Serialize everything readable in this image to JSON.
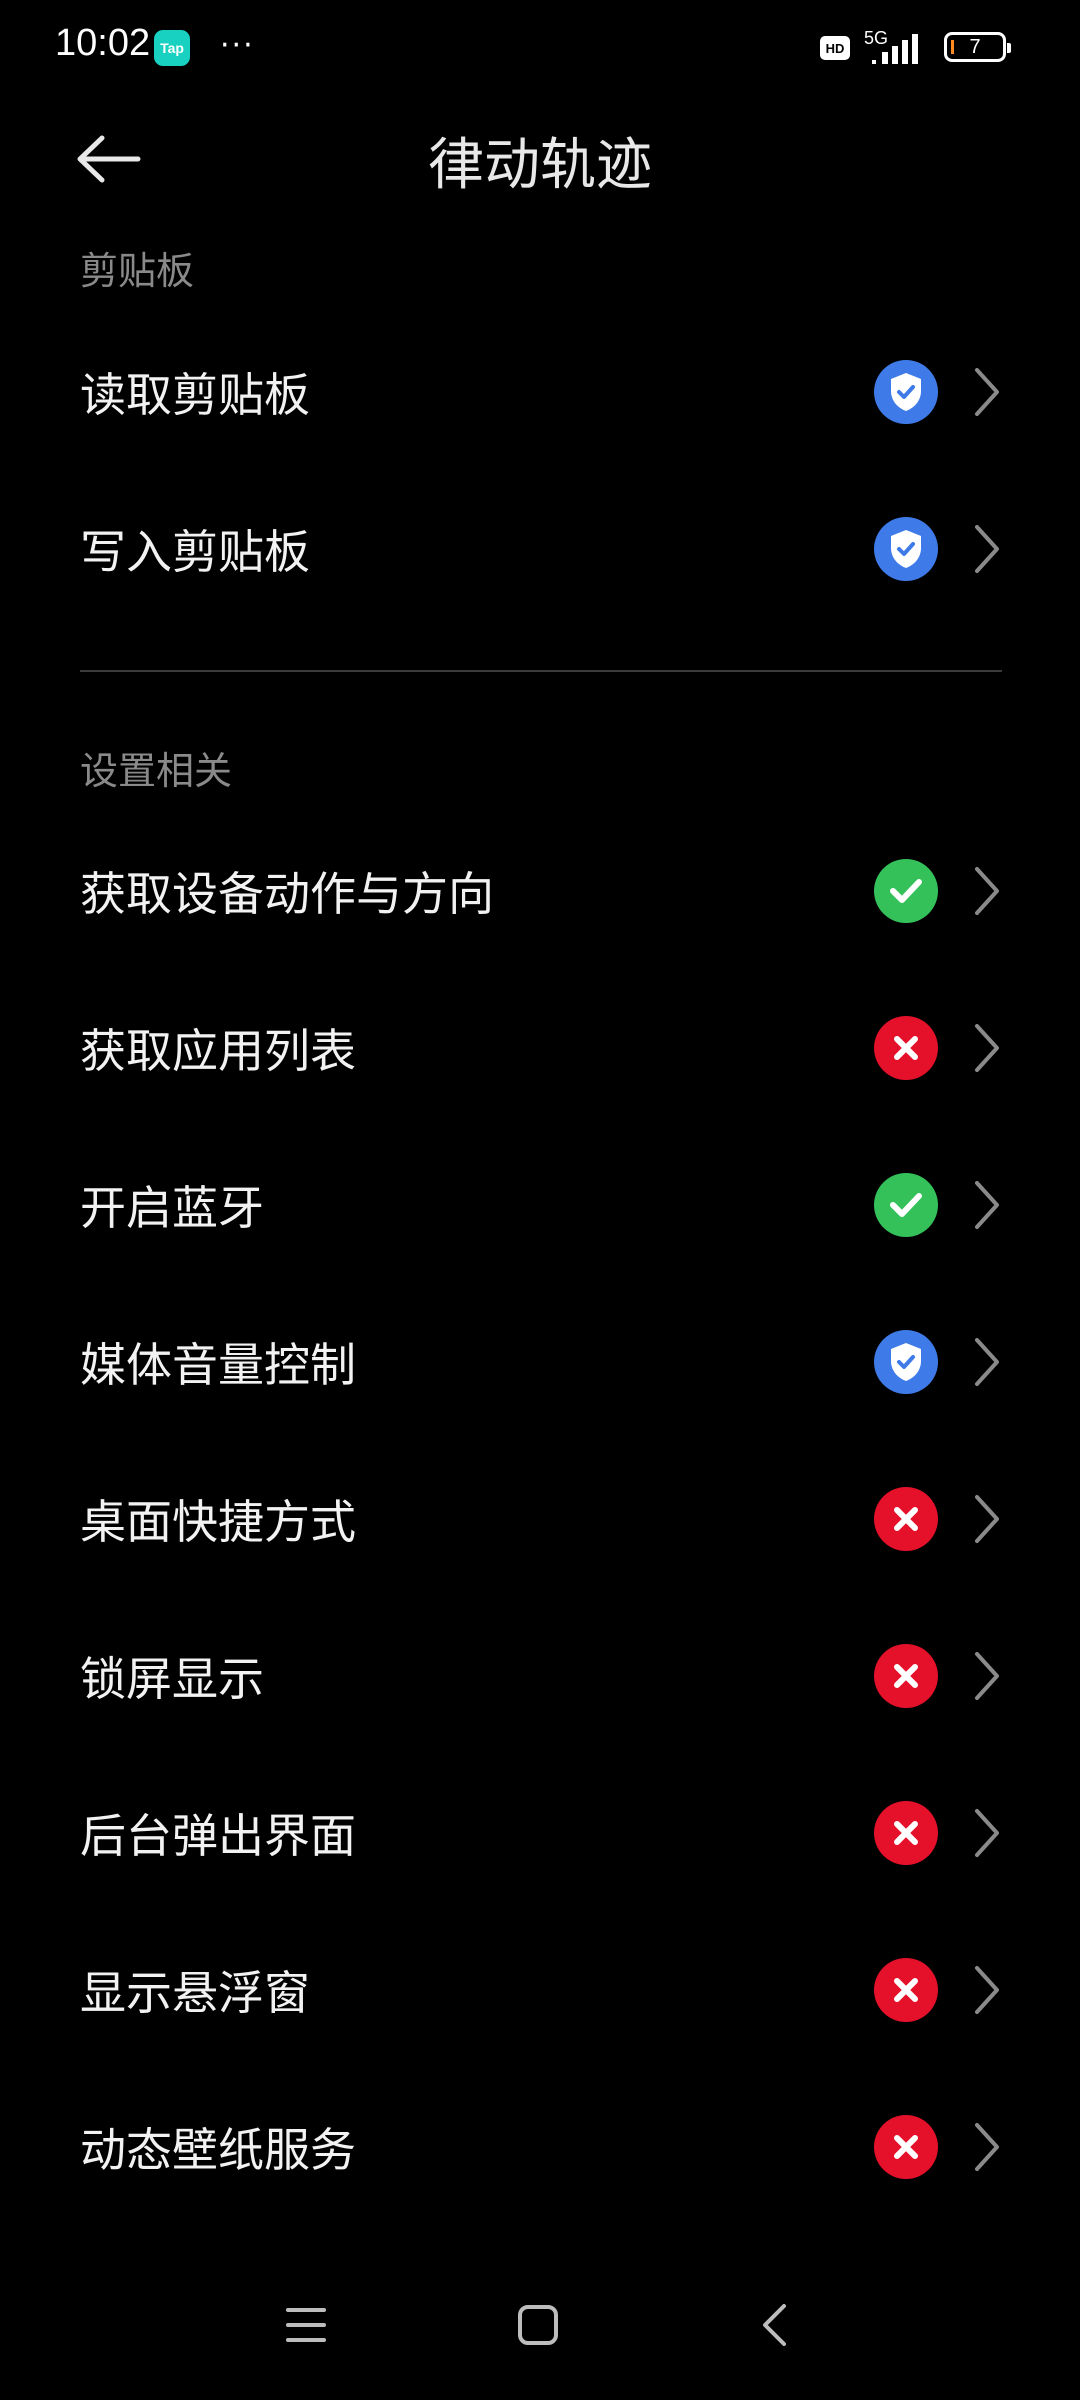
{
  "status_bar": {
    "time": "10:02",
    "app_badge": "Tap",
    "more": "···",
    "hd": "HD",
    "network": "5G",
    "battery": "7"
  },
  "header": {
    "title": "律动轨迹"
  },
  "sections": [
    {
      "title": "剪贴板",
      "items": [
        {
          "label": "读取剪贴板",
          "status": "ask"
        },
        {
          "label": "写入剪贴板",
          "status": "ask"
        }
      ]
    },
    {
      "title": "设置相关",
      "items": [
        {
          "label": "获取设备动作与方向",
          "status": "allowed"
        },
        {
          "label": "获取应用列表",
          "status": "denied"
        },
        {
          "label": "开启蓝牙",
          "status": "allowed"
        },
        {
          "label": "媒体音量控制",
          "status": "ask"
        },
        {
          "label": "桌面快捷方式",
          "status": "denied"
        },
        {
          "label": "锁屏显示",
          "status": "denied"
        },
        {
          "label": "后台弹出界面",
          "status": "denied"
        },
        {
          "label": "显示悬浮窗",
          "status": "denied"
        },
        {
          "label": "动态壁纸服务",
          "status": "denied"
        }
      ]
    }
  ],
  "colors": {
    "ask": "#3f7be8",
    "allowed": "#34c15a",
    "denied": "#e5102a"
  }
}
